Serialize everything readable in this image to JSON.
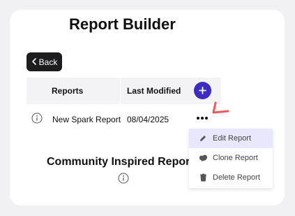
{
  "page": {
    "title": "Report Builder"
  },
  "toolbar": {
    "back_label": "Back"
  },
  "table": {
    "columns": [
      "Reports",
      "Last Modified"
    ],
    "rows": [
      {
        "name": "New Spark Report",
        "last_modified": "08/04/2025"
      }
    ]
  },
  "community": {
    "title": "Community Inspired Reports"
  },
  "context_menu": {
    "items": [
      {
        "label": "Edit Report",
        "icon": "pencil-icon",
        "highlighted": true
      },
      {
        "label": "Clone Report",
        "icon": "clone-icon",
        "highlighted": false
      },
      {
        "label": "Delete Report",
        "icon": "trash-icon",
        "highlighted": false
      }
    ]
  },
  "colors": {
    "accent": "#3f2bc4",
    "back_button": "#1d1d1f",
    "annotation": "#f05a5a",
    "menu_highlight": "#e9e7fb",
    "header_bg": "#f3f3f6"
  }
}
